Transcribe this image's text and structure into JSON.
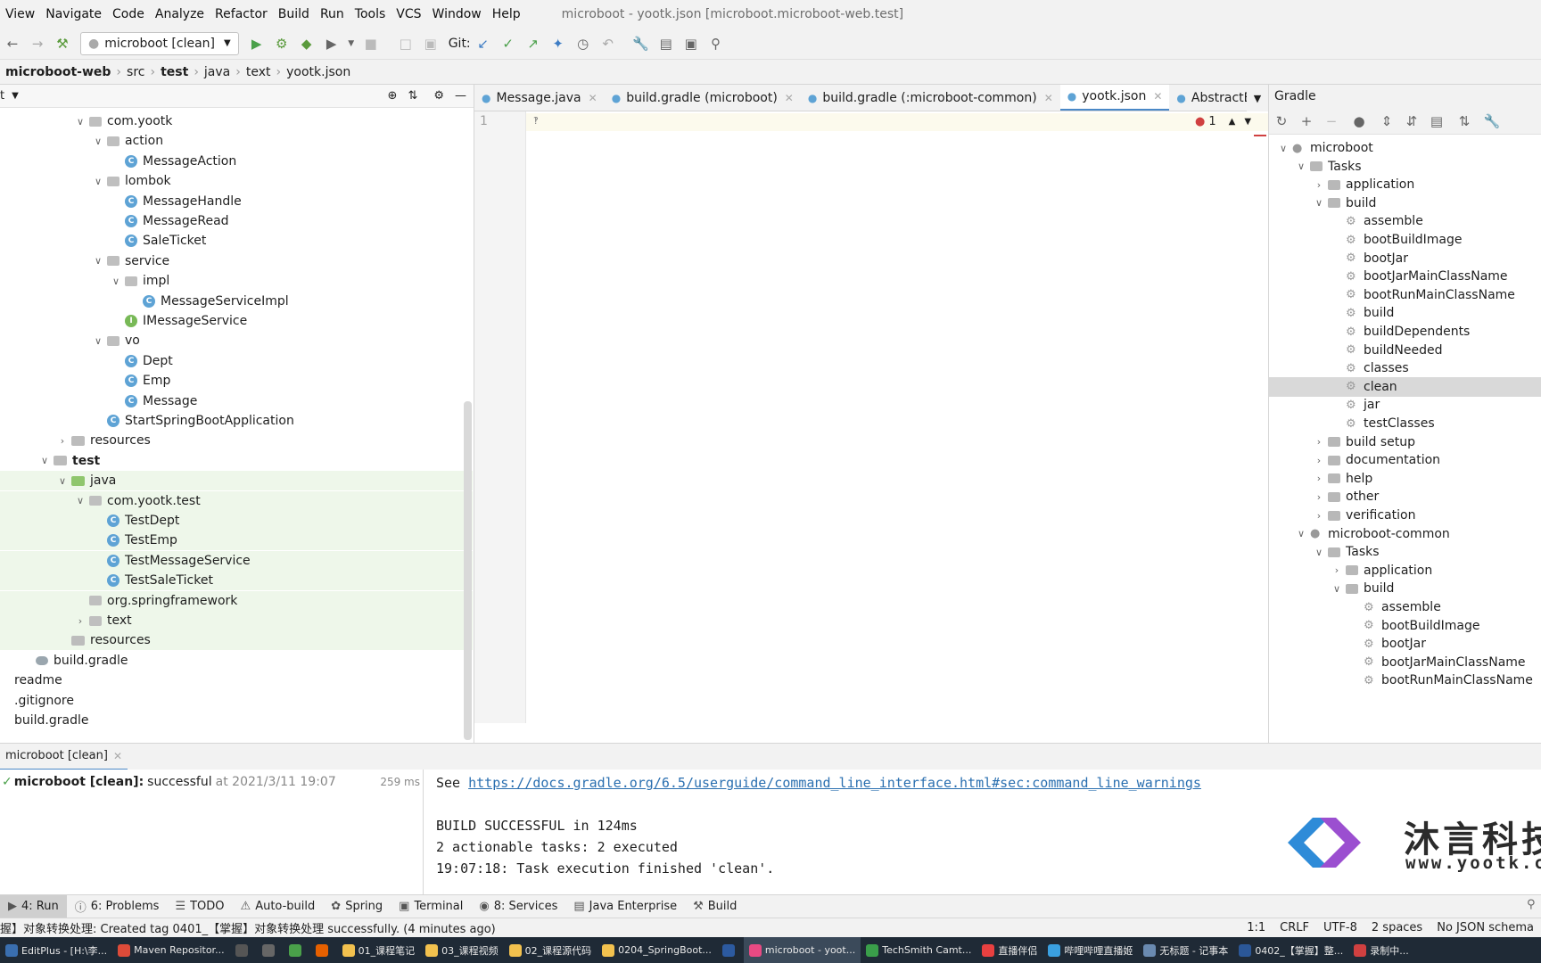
{
  "menu": [
    "View",
    "Navigate",
    "Code",
    "Analyze",
    "Refactor",
    "Build",
    "Run",
    "Tools",
    "VCS",
    "Window",
    "Help"
  ],
  "window_title": "microboot - yootk.json [microboot.microboot-web.test]",
  "toolbar": {
    "run_config": "microboot [clean]",
    "git_label": "Git:"
  },
  "breadcrumb": [
    "microboot-web",
    "src",
    "test",
    "java",
    "text",
    "yootk.json"
  ],
  "project_tree": {
    "root_label": "t",
    "rows": [
      {
        "label": "com.yootk",
        "indent": 2,
        "type": "pkg",
        "arrow": "down"
      },
      {
        "label": "action",
        "indent": 3,
        "type": "pkg",
        "arrow": "down"
      },
      {
        "label": "MessageAction",
        "indent": 4,
        "type": "cls",
        "arrow": ""
      },
      {
        "label": "lombok",
        "indent": 3,
        "type": "pkg",
        "arrow": "down"
      },
      {
        "label": "MessageHandle",
        "indent": 4,
        "type": "cls",
        "arrow": ""
      },
      {
        "label": "MessageRead",
        "indent": 4,
        "type": "cls",
        "arrow": ""
      },
      {
        "label": "SaleTicket",
        "indent": 4,
        "type": "cls",
        "arrow": ""
      },
      {
        "label": "service",
        "indent": 3,
        "type": "pkg",
        "arrow": "down"
      },
      {
        "label": "impl",
        "indent": 4,
        "type": "pkg",
        "arrow": "down"
      },
      {
        "label": "MessageServiceImpl",
        "indent": 5,
        "type": "cls",
        "arrow": ""
      },
      {
        "label": "IMessageService",
        "indent": 4,
        "type": "intf",
        "arrow": ""
      },
      {
        "label": "vo",
        "indent": 3,
        "type": "pkg",
        "arrow": "down"
      },
      {
        "label": "Dept",
        "indent": 4,
        "type": "cls",
        "arrow": ""
      },
      {
        "label": "Emp",
        "indent": 4,
        "type": "cls",
        "arrow": ""
      },
      {
        "label": "Message",
        "indent": 4,
        "type": "cls",
        "arrow": ""
      },
      {
        "label": "StartSpringBootApplication",
        "indent": 3,
        "type": "cls",
        "arrow": ""
      },
      {
        "label": "resources",
        "indent": 1,
        "type": "folder",
        "arrow": "right"
      },
      {
        "label": "test",
        "indent": 0,
        "type": "folder",
        "arrow": "down",
        "bold": true
      },
      {
        "label": "java",
        "indent": 1,
        "type": "folder-green",
        "arrow": "down",
        "hl": true
      },
      {
        "label": "com.yootk.test",
        "indent": 2,
        "type": "pkg",
        "arrow": "down",
        "hl": true
      },
      {
        "label": "TestDept",
        "indent": 3,
        "type": "cls",
        "arrow": "",
        "hl": true
      },
      {
        "label": "TestEmp",
        "indent": 3,
        "type": "cls",
        "arrow": "",
        "hl": true
      },
      {
        "label": "TestMessageService",
        "indent": 3,
        "type": "cls",
        "arrow": "",
        "hl": true
      },
      {
        "label": "TestSaleTicket",
        "indent": 3,
        "type": "cls",
        "arrow": "",
        "hl": true
      },
      {
        "label": "org.springframework",
        "indent": 2,
        "type": "pkg",
        "arrow": "",
        "hl": true
      },
      {
        "label": "text",
        "indent": 2,
        "type": "pkg",
        "arrow": "right",
        "hl": true
      },
      {
        "label": "resources",
        "indent": 1,
        "type": "folder",
        "arrow": "",
        "hl": true
      },
      {
        "label": "build.gradle",
        "indent": -1,
        "type": "gradle",
        "arrow": ""
      },
      {
        "label": "readme",
        "indent": -2,
        "type": "none",
        "arrow": ""
      },
      {
        "label": ".gitignore",
        "indent": -2,
        "type": "none",
        "arrow": ""
      },
      {
        "label": "build.gradle",
        "indent": -2,
        "type": "none",
        "arrow": ""
      }
    ]
  },
  "editor": {
    "tabs": [
      {
        "label": "Message.java",
        "active": false
      },
      {
        "label": "build.gradle (microboot)",
        "active": false
      },
      {
        "label": "build.gradle (:microboot-common)",
        "active": false
      },
      {
        "label": "yootk.json",
        "active": true
      },
      {
        "label": "AbstractBas",
        "active": false
      }
    ],
    "line_number": "1",
    "error_count": "1"
  },
  "gradle": {
    "title": "Gradle",
    "rows": [
      {
        "label": "microboot",
        "indent": 0,
        "kind": "project",
        "arrow": "down"
      },
      {
        "label": "Tasks",
        "indent": 1,
        "kind": "folder",
        "arrow": "down"
      },
      {
        "label": "application",
        "indent": 2,
        "kind": "folder",
        "arrow": "right"
      },
      {
        "label": "build",
        "indent": 2,
        "kind": "folder",
        "arrow": "down"
      },
      {
        "label": "assemble",
        "indent": 3,
        "kind": "task",
        "arrow": ""
      },
      {
        "label": "bootBuildImage",
        "indent": 3,
        "kind": "task",
        "arrow": ""
      },
      {
        "label": "bootJar",
        "indent": 3,
        "kind": "task",
        "arrow": ""
      },
      {
        "label": "bootJarMainClassName",
        "indent": 3,
        "kind": "task",
        "arrow": ""
      },
      {
        "label": "bootRunMainClassName",
        "indent": 3,
        "kind": "task",
        "arrow": ""
      },
      {
        "label": "build",
        "indent": 3,
        "kind": "task",
        "arrow": ""
      },
      {
        "label": "buildDependents",
        "indent": 3,
        "kind": "task",
        "arrow": ""
      },
      {
        "label": "buildNeeded",
        "indent": 3,
        "kind": "task",
        "arrow": ""
      },
      {
        "label": "classes",
        "indent": 3,
        "kind": "task",
        "arrow": ""
      },
      {
        "label": "clean",
        "indent": 3,
        "kind": "task",
        "arrow": "",
        "sel": true
      },
      {
        "label": "jar",
        "indent": 3,
        "kind": "task",
        "arrow": ""
      },
      {
        "label": "testClasses",
        "indent": 3,
        "kind": "task",
        "arrow": ""
      },
      {
        "label": "build setup",
        "indent": 2,
        "kind": "folder",
        "arrow": "right"
      },
      {
        "label": "documentation",
        "indent": 2,
        "kind": "folder",
        "arrow": "right"
      },
      {
        "label": "help",
        "indent": 2,
        "kind": "folder",
        "arrow": "right"
      },
      {
        "label": "other",
        "indent": 2,
        "kind": "folder",
        "arrow": "right"
      },
      {
        "label": "verification",
        "indent": 2,
        "kind": "folder",
        "arrow": "right"
      },
      {
        "label": "microboot-common",
        "indent": 1,
        "kind": "project",
        "arrow": "down"
      },
      {
        "label": "Tasks",
        "indent": 2,
        "kind": "folder",
        "arrow": "down"
      },
      {
        "label": "application",
        "indent": 3,
        "kind": "folder",
        "arrow": "right"
      },
      {
        "label": "build",
        "indent": 3,
        "kind": "folder",
        "arrow": "down"
      },
      {
        "label": "assemble",
        "indent": 4,
        "kind": "task",
        "arrow": ""
      },
      {
        "label": "bootBuildImage",
        "indent": 4,
        "kind": "task",
        "arrow": ""
      },
      {
        "label": "bootJar",
        "indent": 4,
        "kind": "task",
        "arrow": ""
      },
      {
        "label": "bootJarMainClassName",
        "indent": 4,
        "kind": "task",
        "arrow": ""
      },
      {
        "label": "bootRunMainClassName",
        "indent": 4,
        "kind": "task",
        "arrow": ""
      }
    ]
  },
  "run": {
    "tab_label": "microboot [clean]",
    "result_name": "microboot [clean]:",
    "result_status": "successful",
    "result_time": "at 2021/3/11 19:07",
    "duration": "259 ms",
    "console": {
      "see": "See ",
      "link": "https://docs.gradle.org/6.5/userguide/command_line_interface.html#sec:command_line_warnings",
      "line2": "BUILD SUCCESSFUL in 124ms",
      "line3": "2 actionable tasks: 2 executed",
      "line4": "19:07:18: Task execution finished 'clean'."
    }
  },
  "tool_windows": [
    "4: Run",
    "6: Problems",
    "TODO",
    "Auto-build",
    "Spring",
    "Terminal",
    "8: Services",
    "Java Enterprise",
    "Build"
  ],
  "status": {
    "message": "握】对象转换处理: Created tag 0401_【掌握】对象转换处理 successfully. (4 minutes ago)",
    "right": [
      "1:1",
      "CRLF",
      "UTF-8",
      "2 spaces",
      "No JSON schema"
    ]
  },
  "taskbar": [
    "EditPlus - [H:\\李...",
    "Maven Repositor...",
    "",
    "",
    "",
    "",
    "01_课程笔记",
    "03_课程视频",
    "02_课程源代码",
    "0204_SpringBoot...",
    "",
    "microboot - yoot...",
    "TechSmith Camt...",
    "直播伴侣",
    "哔哩哔哩直播姬",
    "无标题 - 记事本",
    "0402_【掌握】整...",
    "录制中..."
  ],
  "watermark": {
    "brand": "沐言科技",
    "url": "www.yootk.com"
  },
  "colors": {
    "accent": "#4a88c7",
    "test_highlight": "#eef7ea",
    "selection": "#d9d9d9"
  }
}
